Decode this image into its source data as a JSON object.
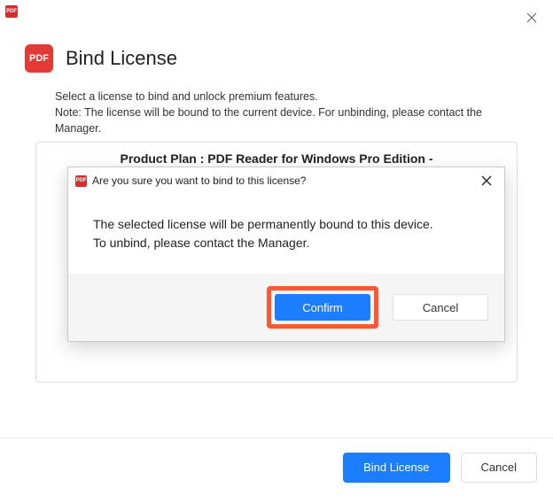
{
  "app_icon_text": "PDF",
  "header": {
    "icon_text": "PDF",
    "title": "Bind License"
  },
  "description": {
    "line1": "Select a license to bind and unlock premium features.",
    "line2": "Note: The license will be bound to the current device. For unbinding, please contact the Manager."
  },
  "license": {
    "plan_label": "Product Plan : PDF Reader for Windows Pro Edition -"
  },
  "bottom": {
    "bind_label": "Bind License",
    "cancel_label": "Cancel"
  },
  "modal": {
    "icon_text": "PDF",
    "title": "Are you sure you want to bind to this license?",
    "body_line1": "The selected license will be permanently bound to this device.",
    "body_line2": "To unbind, please contact the Manager.",
    "confirm_label": "Confirm",
    "cancel_label": "Cancel"
  }
}
